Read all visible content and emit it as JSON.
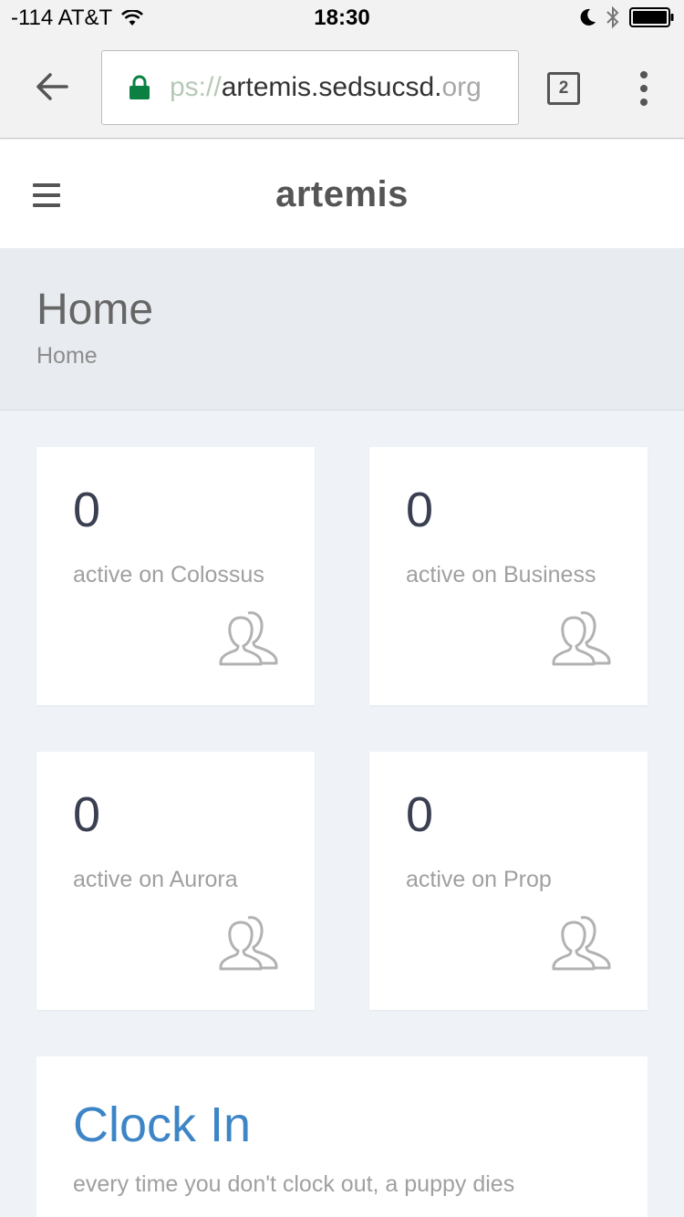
{
  "status_bar": {
    "signal": "-114 AT&T",
    "time": "18:30"
  },
  "browser": {
    "url_prefix": "ps://",
    "url_host": "artemis.sedsucsd.",
    "url_suffix": "org",
    "tab_count": "2"
  },
  "app": {
    "brand": "artemis"
  },
  "page": {
    "title": "Home",
    "breadcrumb": "Home"
  },
  "stats": [
    {
      "count": "0",
      "label": "active on Colossus"
    },
    {
      "count": "0",
      "label": "active on Business"
    },
    {
      "count": "0",
      "label": "active on Aurora"
    },
    {
      "count": "0",
      "label": "active on Prop"
    }
  ],
  "clock": {
    "title": "Clock In",
    "subtitle": "every time you don't clock out, a puppy dies"
  },
  "colors": {
    "accent_link": "#3d85c6",
    "lock_green": "#0b8043",
    "page_bg": "#eff2f6",
    "header_band": "#e8ebf0"
  },
  "icons": [
    "back-arrow-icon",
    "lock-icon",
    "tab-switcher-icon",
    "overflow-menu-icon",
    "hamburger-icon",
    "users-icon",
    "wifi-icon",
    "moon-icon",
    "bluetooth-icon",
    "battery-icon"
  ]
}
